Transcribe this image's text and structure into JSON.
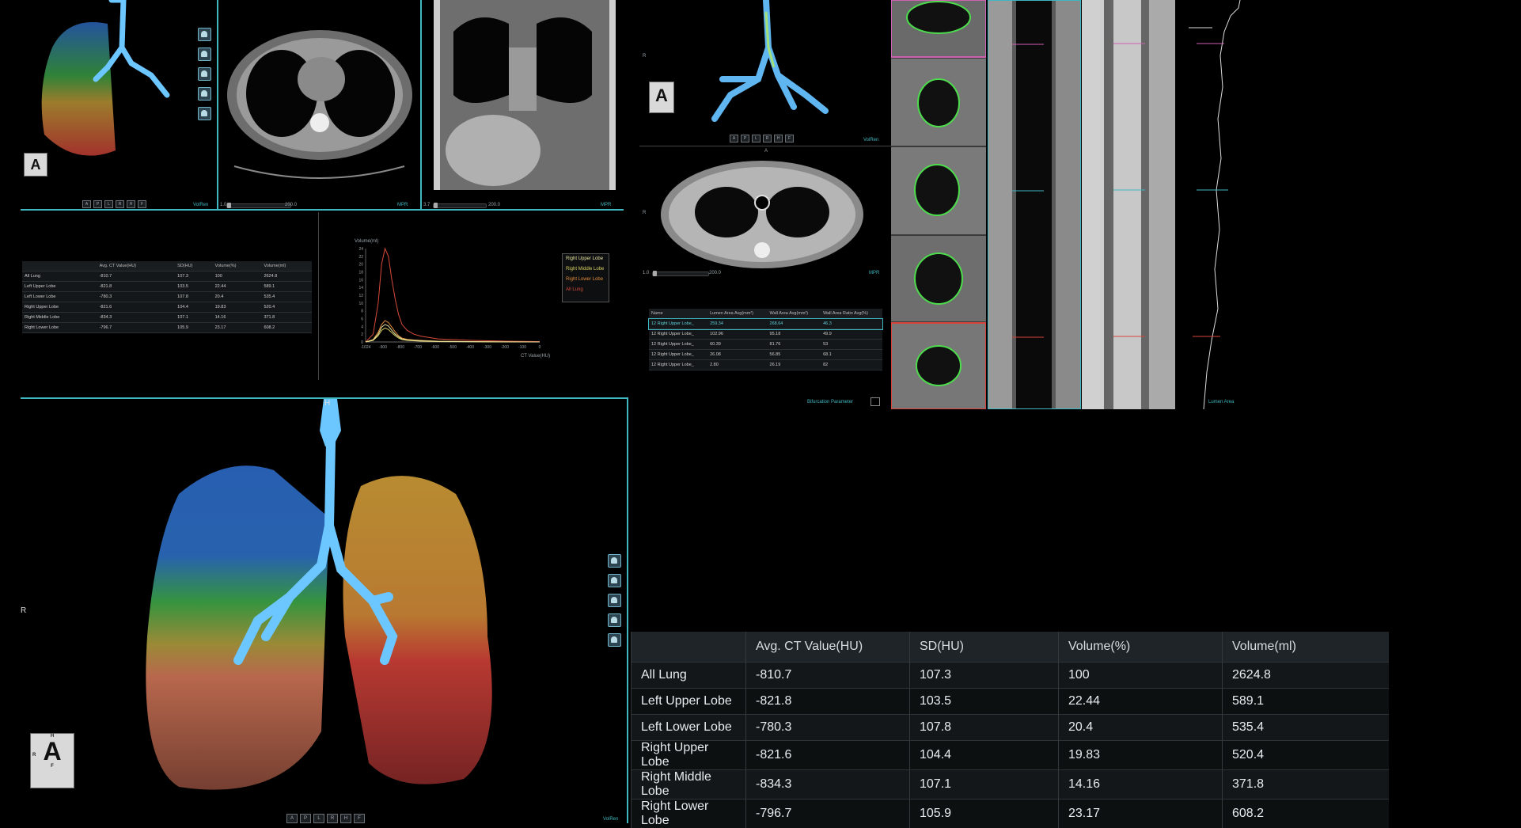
{
  "top_left_viewer": {
    "nav_buttons": [
      "A",
      "P",
      "L",
      "R",
      "H",
      "F"
    ],
    "mode_label": "VolRen",
    "orientation_letter": "A"
  },
  "axial_view": {
    "min": "1.0",
    "max": "200.0",
    "mode_label": "MPR"
  },
  "coronal_view": {
    "min": "3.7",
    "max": "200.0",
    "mode_label": "MPR"
  },
  "lobe_stats_small": {
    "columns": [
      "",
      "Avg. CT Value(HU)",
      "SD(HU)",
      "Volume(%)",
      "Volume(ml)"
    ],
    "rows": [
      [
        "All Lung",
        "-810.7",
        "107.3",
        "100",
        "2624.8"
      ],
      [
        "Left Upper Lobe",
        "-821.8",
        "103.5",
        "22.44",
        "589.1"
      ],
      [
        "Left Lower Lobe",
        "-780.3",
        "107.8",
        "20.4",
        "535.4"
      ],
      [
        "Right Upper Lobe",
        "-821.6",
        "104.4",
        "19.83",
        "520.4"
      ],
      [
        "Right Middle Lobe",
        "-834.3",
        "107.1",
        "14.16",
        "371.8"
      ],
      [
        "Right Lower Lobe",
        "-796.7",
        "105.9",
        "23.17",
        "608.2"
      ]
    ]
  },
  "histogram": {
    "ylabel": "Volume(ml)",
    "xlabel": "CT Value(HU)",
    "legend": [
      "Right Upper Lobe",
      "Right Middle Lobe",
      "Right Lower Lobe",
      "All Lung"
    ]
  },
  "chart_data": {
    "type": "line",
    "ylabel": "Volume(ml)",
    "xlabel": "CT Value(HU)",
    "ylim": [
      0,
      24
    ],
    "yticks": [
      "0",
      "2",
      "4",
      "6",
      "8",
      "10",
      "12",
      "14",
      "16",
      "18",
      "20",
      "22",
      "24"
    ],
    "xticks": [
      "-1024",
      "-900",
      "-800",
      "-700",
      "-600",
      "-500",
      "-400",
      "-300",
      "-200",
      "-100",
      "0"
    ],
    "x": [
      -1024,
      -980,
      -950,
      -930,
      -910,
      -890,
      -870,
      -850,
      -830,
      -810,
      -780,
      -740,
      -700,
      -600,
      -400,
      -200,
      0
    ],
    "series": [
      {
        "name": "All Lung",
        "color": "#d84a3a",
        "values": [
          0,
          2,
          10,
          20,
          24,
          22,
          16,
          11,
          7,
          4.5,
          3,
          2,
          1.5,
          0.8,
          0.4,
          0.2,
          0.1
        ]
      },
      {
        "name": "Right Lower Lobe",
        "color": "#e08a3a",
        "values": [
          0,
          0.6,
          2.5,
          4.5,
          5.5,
          5,
          3.8,
          2.6,
          1.6,
          1,
          0.7,
          0.5,
          0.4,
          0.2,
          0.1,
          0.05,
          0
        ]
      },
      {
        "name": "Right Middle Lobe",
        "color": "#d8d060",
        "values": [
          0,
          0.4,
          1.6,
          3,
          3.6,
          3.2,
          2.4,
          1.6,
          1,
          0.6,
          0.4,
          0.3,
          0.2,
          0.1,
          0.05,
          0,
          0
        ]
      },
      {
        "name": "Right Upper Lobe",
        "color": "#e8e2a0",
        "values": [
          0,
          0.5,
          2,
          3.8,
          4.5,
          4.1,
          3,
          2,
          1.3,
          0.8,
          0.5,
          0.4,
          0.3,
          0.15,
          0.08,
          0.03,
          0
        ]
      }
    ]
  },
  "airway_3d": {
    "label": "R",
    "nav_buttons": [
      "A",
      "P",
      "L",
      "R",
      "H",
      "F"
    ],
    "mode_label": "VolRen",
    "orientation_letter": "A"
  },
  "airway_axial": {
    "min": "1.0",
    "max": "200.0",
    "mode_label": "MPR",
    "top_letter": "A",
    "left_letter": "R"
  },
  "airway_table": {
    "columns": [
      "Name",
      "Lumen Area Avg(mm²)",
      "Wall Area Avg(mm²)",
      "Wall Area Ratio Avg(%)"
    ],
    "rows": [
      [
        "12 Right Upper Lobe_",
        "259.34",
        "268.64",
        "46.3"
      ],
      [
        "12 Right Upper Lobe_",
        "102.96",
        "95.18",
        "49.9"
      ],
      [
        "12 Right Upper Lobe_",
        "60.39",
        "81.76",
        "53"
      ],
      [
        "12 Right Upper Lobe_",
        "26.08",
        "56.85",
        "68.1"
      ],
      [
        "12 Right Upper Lobe_",
        "2.80",
        "26.19",
        "82"
      ]
    ],
    "footer_label": "Bifurcation Parameter"
  },
  "lumen_plot": {
    "label": "Lumen Area"
  },
  "main_3d": {
    "top_label": "H",
    "left_label": "R",
    "nav_buttons": [
      "A",
      "P",
      "L",
      "R",
      "H",
      "F"
    ],
    "mode_label": "VolRen",
    "orientation": {
      "top": "H",
      "left": "R",
      "letter": "A",
      "bottom": "F"
    }
  },
  "big_table": {
    "columns": [
      "",
      "Avg. CT Value(HU)",
      "SD(HU)",
      "Volume(%)",
      "Volume(ml)"
    ],
    "rows": [
      [
        "All Lung",
        "-810.7",
        "107.3",
        "100",
        "2624.8"
      ],
      [
        "Left Upper Lobe",
        "-821.8",
        "103.5",
        "22.44",
        "589.1"
      ],
      [
        "Left Lower Lobe",
        "-780.3",
        "107.8",
        "20.4",
        "535.4"
      ],
      [
        "Right Upper Lobe",
        "-821.6",
        "104.4",
        "19.83",
        "520.4"
      ],
      [
        "Right Middle Lobe",
        "-834.3",
        "107.1",
        "14.16",
        "371.8"
      ],
      [
        "Right Lower Lobe",
        "-796.7",
        "105.9",
        "23.17",
        "608.2"
      ]
    ]
  },
  "colors": {
    "accent": "#3fb7c0",
    "upper": "#2f6fd0",
    "middle": "#3fae4a",
    "lower": "#d8433a",
    "left_lung": "#d8a43a"
  }
}
